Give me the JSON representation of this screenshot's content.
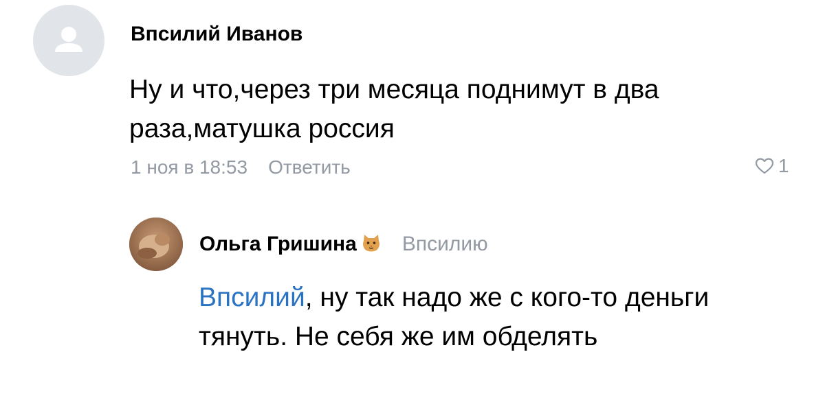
{
  "comment": {
    "author": "Впсилий Иванов",
    "text": "Ну и что,через три месяца поднимут в два раза,матушка россия",
    "date": "1 ноя в 18:53",
    "reply_label": "Ответить",
    "likes": "1"
  },
  "reply": {
    "author": "Ольга Гришина",
    "reply_to": "Впсилию",
    "mention": "Впсилий",
    "text": ", ну так надо же с кого-то деньги тянуть. Не себя же им обделять"
  },
  "colors": {
    "muted": "#939aa4",
    "mention": "#2a72c2",
    "avatar_placeholder": "#e1e4e8"
  },
  "icons": {
    "placeholder_avatar": "user-silhouette-icon",
    "like": "heart-icon",
    "author_badge": "cat-face-icon"
  }
}
